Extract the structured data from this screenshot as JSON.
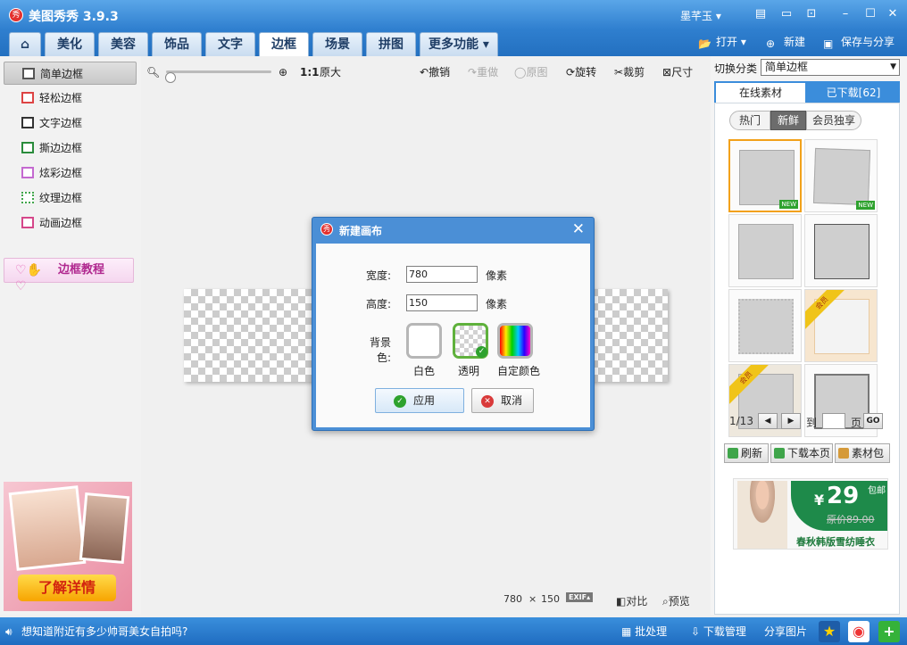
{
  "app": {
    "title": "美图秀秀 3.9.3",
    "logo_glyph": "秀",
    "username": "墨芊玉",
    "window_controls": [
      "skin-icon",
      "feedback-icon",
      "menu-icon",
      "minimize-icon",
      "maximize-icon",
      "close-icon"
    ]
  },
  "nav": {
    "tabs": [
      {
        "label": "",
        "icon": "home-icon"
      },
      {
        "label": "美化"
      },
      {
        "label": "美容"
      },
      {
        "label": "饰品"
      },
      {
        "label": "文字"
      },
      {
        "label": "边框",
        "active": true
      },
      {
        "label": "场景"
      },
      {
        "label": "拼图"
      },
      {
        "label": "更多功能"
      }
    ],
    "open_label": "打开",
    "new_label": "新建",
    "save_label": "保存与分享"
  },
  "sidebar": {
    "items": [
      {
        "label": "简单边框",
        "active": true
      },
      {
        "label": "轻松边框"
      },
      {
        "label": "文字边框"
      },
      {
        "label": "撕边边框"
      },
      {
        "label": "炫彩边框"
      },
      {
        "label": "纹理边框"
      },
      {
        "label": "动画边框"
      }
    ],
    "tutorial_label": "边框教程",
    "ad_cta": "了解详情"
  },
  "toolbar": {
    "ratio_label": "1:1",
    "original_size_label": "原大",
    "undo_label": "撤销",
    "redo_label": "重做",
    "original_label": "原图",
    "rotate_label": "旋转",
    "crop_label": "裁剪",
    "resize_label": "尺寸",
    "zoom_level": 0.05
  },
  "canvas_status": {
    "width": "780",
    "times": "×",
    "height": "150",
    "exif_label": "EXIF",
    "compare_label": "对比",
    "preview_label": "预览"
  },
  "right_panel": {
    "category_label": "切换分类",
    "category_value": "简单边框",
    "tab_online": "在线素材",
    "tab_downloaded": "已下载[62]",
    "filters": [
      "热门",
      "新鲜",
      "会员独享"
    ],
    "active_filter": "新鲜",
    "new_badge": "NEW",
    "vip_badge": "会员",
    "pager": {
      "current": "1/13",
      "goto_label": "到",
      "page_label": "页",
      "go_label": "GO"
    },
    "refresh_label": "刷新",
    "download_page_label": "下载本页",
    "pack_label": "素材包",
    "ad": {
      "price": "29",
      "currency": "¥",
      "shipping": "包邮",
      "old_price": "原价89.00",
      "slogan": "春秋韩版雪纺睡衣"
    }
  },
  "dialog": {
    "title": "新建画布",
    "width_label": "宽度:",
    "width_value": "780",
    "height_label": "高度:",
    "height_value": "150",
    "unit": "像素",
    "bg_label": "背景色:",
    "bg_options": [
      {
        "label": "白色"
      },
      {
        "label": "透明",
        "selected": true
      },
      {
        "label": "自定颜色"
      }
    ],
    "apply_label": "应用",
    "cancel_label": "取消"
  },
  "bottom_bar": {
    "promo_text": "想知道附近有多少帅哥美女自拍吗?",
    "batch_label": "批处理",
    "download_manager_label": "下载管理",
    "share_label": "分享图片"
  }
}
